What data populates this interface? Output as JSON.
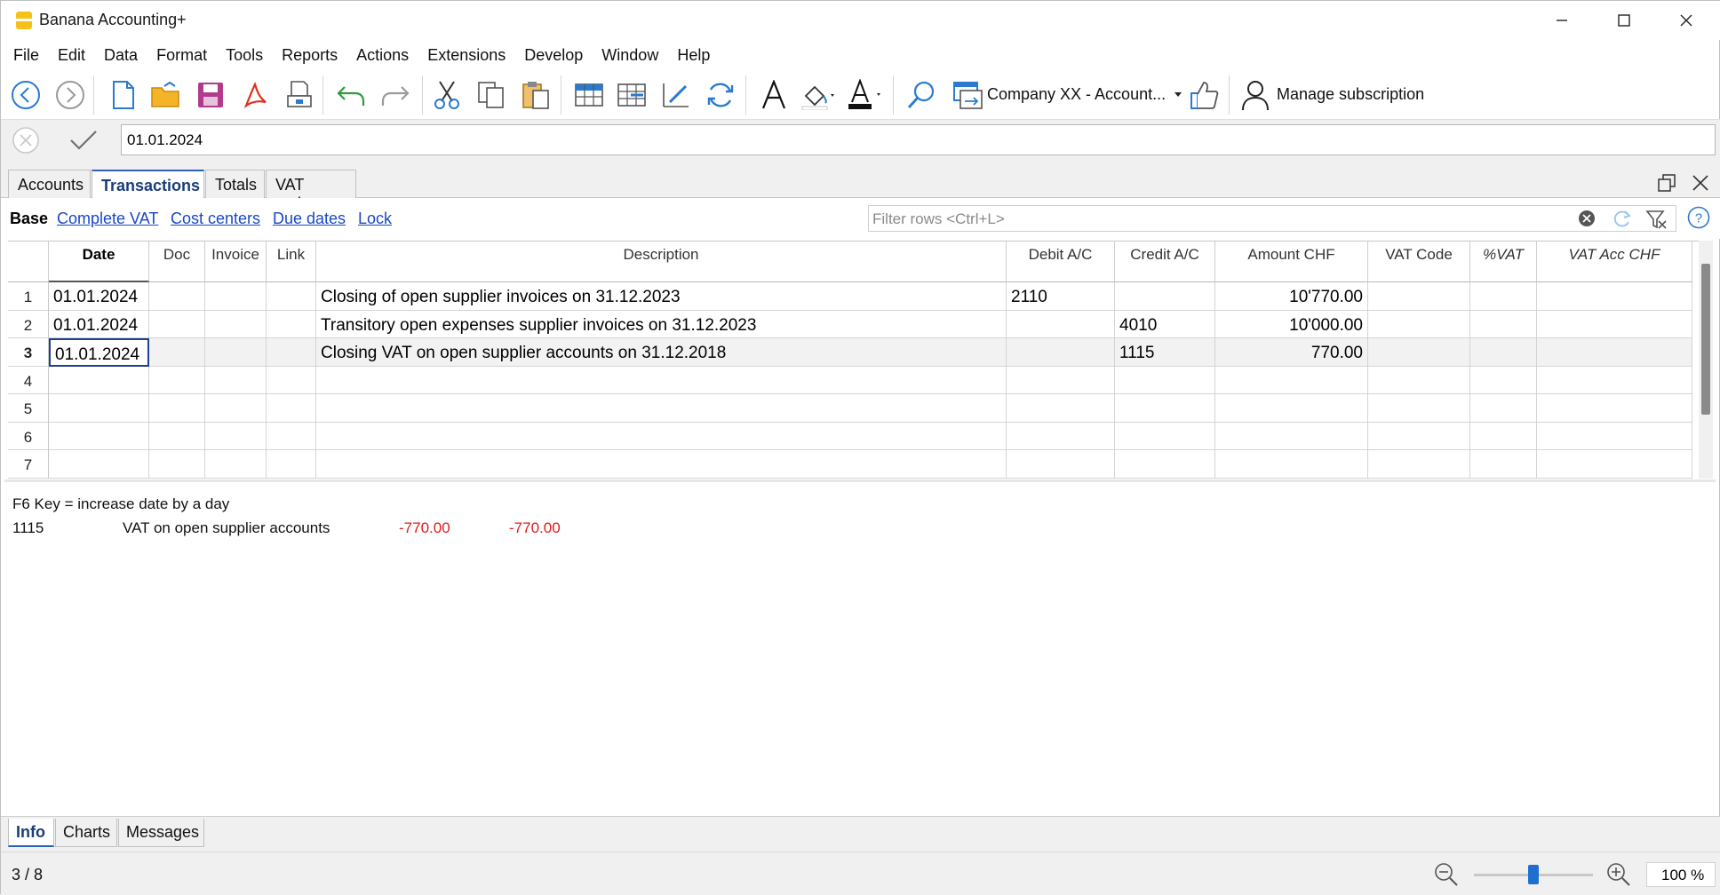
{
  "app": {
    "title": "Banana Accounting+"
  },
  "menu": [
    "File",
    "Edit",
    "Data",
    "Format",
    "Tools",
    "Reports",
    "Actions",
    "Extensions",
    "Develop",
    "Window",
    "Help"
  ],
  "toolbar": {
    "file_selector": "Company XX - Account...",
    "subscription": "Manage subscription"
  },
  "edit_line": {
    "value": "01.01.2024"
  },
  "tables": [
    "Accounts",
    "Transactions",
    "Totals",
    "VAT codes"
  ],
  "active_table": "Transactions",
  "views": {
    "active": "Base",
    "links": [
      "Complete VAT",
      "Cost centers",
      "Due dates",
      "Lock"
    ]
  },
  "filter": {
    "placeholder": "Filter rows <Ctrl+L>"
  },
  "grid": {
    "columns": [
      "Date",
      "Doc",
      "Invoice",
      "Link",
      "Description",
      "Debit A/C",
      "Credit A/C",
      "Amount CHF",
      "VAT Code",
      "%VAT",
      "VAT Acc CHF"
    ],
    "rows": [
      {
        "n": "1",
        "date": "01.01.2024",
        "doc": "",
        "invoice": "",
        "link": "",
        "description": "Closing of open supplier invoices on 31.12.2023",
        "debit": "2110",
        "credit": "",
        "amount": "10'770.00",
        "vat": "",
        "pvat": "",
        "vatacc": ""
      },
      {
        "n": "2",
        "date": "01.01.2024",
        "doc": "",
        "invoice": "",
        "link": "",
        "description": "Transitory open expenses supplier invoices on 31.12.2023",
        "debit": "",
        "credit": "4010",
        "amount": "10'000.00",
        "vat": "",
        "pvat": "",
        "vatacc": ""
      },
      {
        "n": "3",
        "date": "01.01.2024",
        "doc": "",
        "invoice": "",
        "link": "",
        "description": "Closing VAT on open supplier accounts on 31.12.2018",
        "debit": "",
        "credit": "1115",
        "amount": "770.00",
        "vat": "",
        "pvat": "",
        "vatacc": ""
      },
      {
        "n": "4",
        "date": "",
        "doc": "",
        "invoice": "",
        "link": "",
        "description": "",
        "debit": "",
        "credit": "",
        "amount": "",
        "vat": "",
        "pvat": "",
        "vatacc": ""
      },
      {
        "n": "5",
        "date": "",
        "doc": "",
        "invoice": "",
        "link": "",
        "description": "",
        "debit": "",
        "credit": "",
        "amount": "",
        "vat": "",
        "pvat": "",
        "vatacc": ""
      },
      {
        "n": "6",
        "date": "",
        "doc": "",
        "invoice": "",
        "link": "",
        "description": "",
        "debit": "",
        "credit": "",
        "amount": "",
        "vat": "",
        "pvat": "",
        "vatacc": ""
      },
      {
        "n": "7",
        "date": "",
        "doc": "",
        "invoice": "",
        "link": "",
        "description": "",
        "debit": "",
        "credit": "",
        "amount": "",
        "vat": "",
        "pvat": "",
        "vatacc": ""
      }
    ]
  },
  "info": {
    "hint": "F6 Key = increase date by a day",
    "account": "1115",
    "account_desc": "VAT on open supplier accounts",
    "amount1": "-770.00",
    "amount2": "-770.00"
  },
  "bottom_tabs": [
    "Info",
    "Charts",
    "Messages"
  ],
  "status": {
    "position": "3 / 8",
    "zoom": "100 %"
  },
  "colors": {
    "accent": "#2a62b8",
    "link": "#1947c8",
    "negative": "#e01b1b"
  }
}
